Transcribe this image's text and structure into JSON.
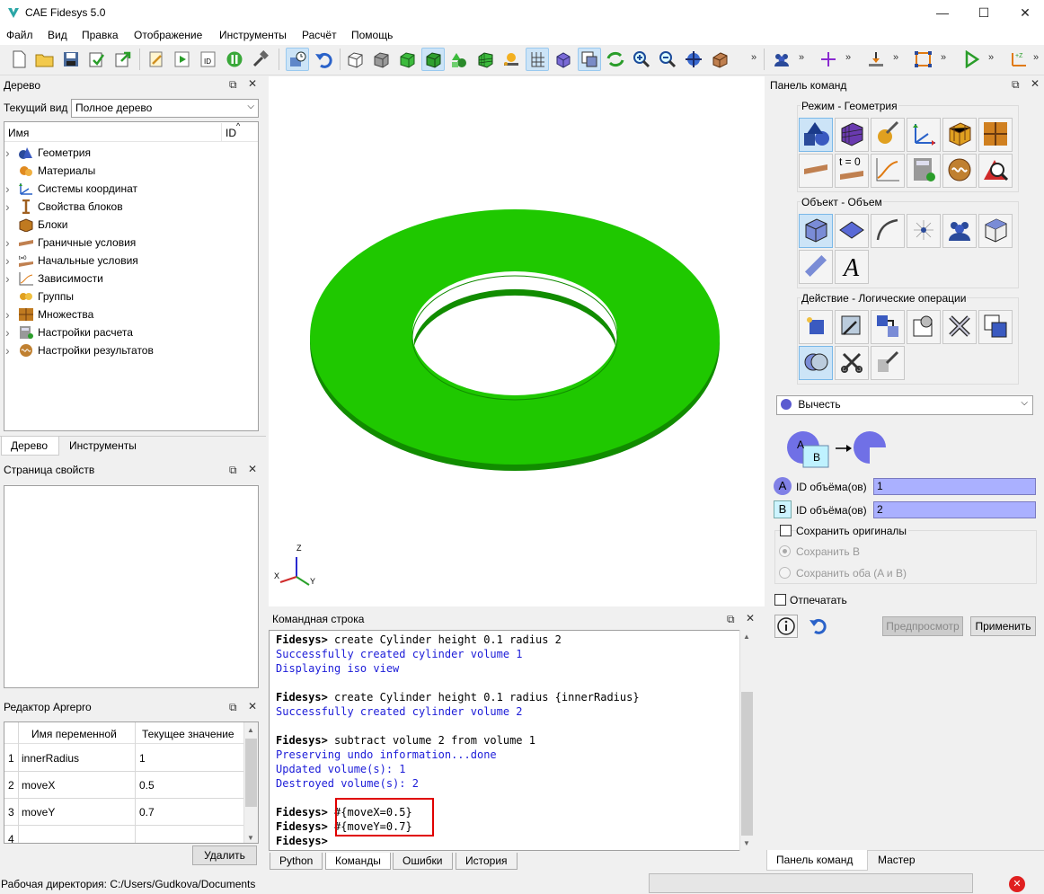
{
  "window": {
    "title": "CAE Fidesys 5.0",
    "minimize": "—",
    "maximize": "☐",
    "close": "✕"
  },
  "menu": [
    "Файл",
    "Вид",
    "Правка",
    "Отображение",
    "Инструменты",
    "Расчёт",
    "Помощь"
  ],
  "tree_dock": {
    "title": "Дерево",
    "view_label": "Текущий вид",
    "view_value": "Полное дерево",
    "col_name": "Имя",
    "col_id": "ID",
    "items": [
      {
        "label": "Геометрия",
        "icon": "geometry-icon",
        "expandable": true
      },
      {
        "label": "Материалы",
        "icon": "materials-icon",
        "expandable": false
      },
      {
        "label": "Системы координат",
        "icon": "coord-systems-icon",
        "expandable": true
      },
      {
        "label": "Свойства блоков",
        "icon": "block-props-icon",
        "expandable": true
      },
      {
        "label": "Блоки",
        "icon": "blocks-icon",
        "expandable": false
      },
      {
        "label": "Граничные условия",
        "icon": "boundary-icon",
        "expandable": true
      },
      {
        "label": "Начальные условия",
        "icon": "initial-icon",
        "expandable": true
      },
      {
        "label": "Зависимости",
        "icon": "dependencies-icon",
        "expandable": true
      },
      {
        "label": "Группы",
        "icon": "groups-icon",
        "expandable": false
      },
      {
        "label": "Множества",
        "icon": "sets-icon",
        "expandable": true
      },
      {
        "label": "Настройки расчета",
        "icon": "calc-settings-icon",
        "expandable": true
      },
      {
        "label": "Настройки результатов",
        "icon": "results-settings-icon",
        "expandable": true
      }
    ],
    "tabs": [
      "Дерево",
      "Инструменты"
    ]
  },
  "props_dock": {
    "title": "Страница свойств"
  },
  "aprepro": {
    "title": "Редактор Aprepro",
    "col_name": "Имя переменной",
    "col_value": "Текущее значение",
    "rows": [
      {
        "n": "1",
        "name": "innerRadius",
        "value": "1"
      },
      {
        "n": "2",
        "name": "moveX",
        "value": "0.5"
      },
      {
        "n": "3",
        "name": "moveY",
        "value": "0.7"
      },
      {
        "n": "4",
        "name": "",
        "value": ""
      }
    ],
    "delete_label": "Удалить"
  },
  "console": {
    "title": "Командная строка",
    "lines": [
      {
        "type": "cmd",
        "prompt": "Fidesys>",
        "text": " create Cylinder height 0.1 radius 2"
      },
      {
        "type": "out",
        "text": "Successfully created cylinder volume 1"
      },
      {
        "type": "out",
        "text": "Displaying iso view"
      },
      {
        "type": "blank",
        "text": ""
      },
      {
        "type": "cmd",
        "prompt": "Fidesys>",
        "text": " create Cylinder height 0.1 radius {innerRadius}"
      },
      {
        "type": "out",
        "text": "Successfully created cylinder volume 2"
      },
      {
        "type": "blank",
        "text": ""
      },
      {
        "type": "cmd",
        "prompt": "Fidesys>",
        "text": " subtract volume 2 from volume 1"
      },
      {
        "type": "out",
        "text": "Preserving undo information...done"
      },
      {
        "type": "out",
        "text": "Updated volume(s): 1"
      },
      {
        "type": "out",
        "text": "Destroyed volume(s): 2"
      },
      {
        "type": "blank",
        "text": ""
      },
      {
        "type": "cmd",
        "prompt": "Fidesys>",
        "text": " #{moveX=0.5}"
      },
      {
        "type": "cmd",
        "prompt": "Fidesys>",
        "text": " #{moveY=0.7}"
      },
      {
        "type": "cmd",
        "prompt": "Fidesys>",
        "text": ""
      }
    ],
    "tabs": [
      "Python",
      "Команды",
      "Ошибки",
      "История"
    ]
  },
  "axes": {
    "z": "Z",
    "x": "X",
    "y": "Y"
  },
  "command_panel": {
    "title": "Панель команд",
    "mode_label": "Режим - Геометрия",
    "object_label": "Объект - Объем",
    "action_label": "Действие - Логические операции",
    "operation": "Вычесть",
    "diagram_a": "A",
    "diagram_b": "B",
    "field_a_letter": "A",
    "field_a_label": "ID объёма(ов)",
    "field_a_value": "1",
    "field_b_letter": "B",
    "field_b_label": "ID объёма(ов)",
    "field_b_value": "2",
    "keep_originals": "Сохранить оригиналы",
    "keep_b": "Сохранить B",
    "keep_both": "Сохранить оба (A и B)",
    "print": "Отпечатать",
    "preview": "Предпросмотр",
    "apply": "Применить",
    "t0_label": "t = 0",
    "tabs": [
      "Панель команд",
      "Мастер"
    ]
  },
  "status": {
    "workdir": "Рабочая директория: C:/Users/Gudkova/Documents"
  },
  "colors": {
    "accent": "#0078d7",
    "ring_green": "#1fc800",
    "console_blue": "#1c1cd8",
    "highlight_red": "#e00000"
  }
}
